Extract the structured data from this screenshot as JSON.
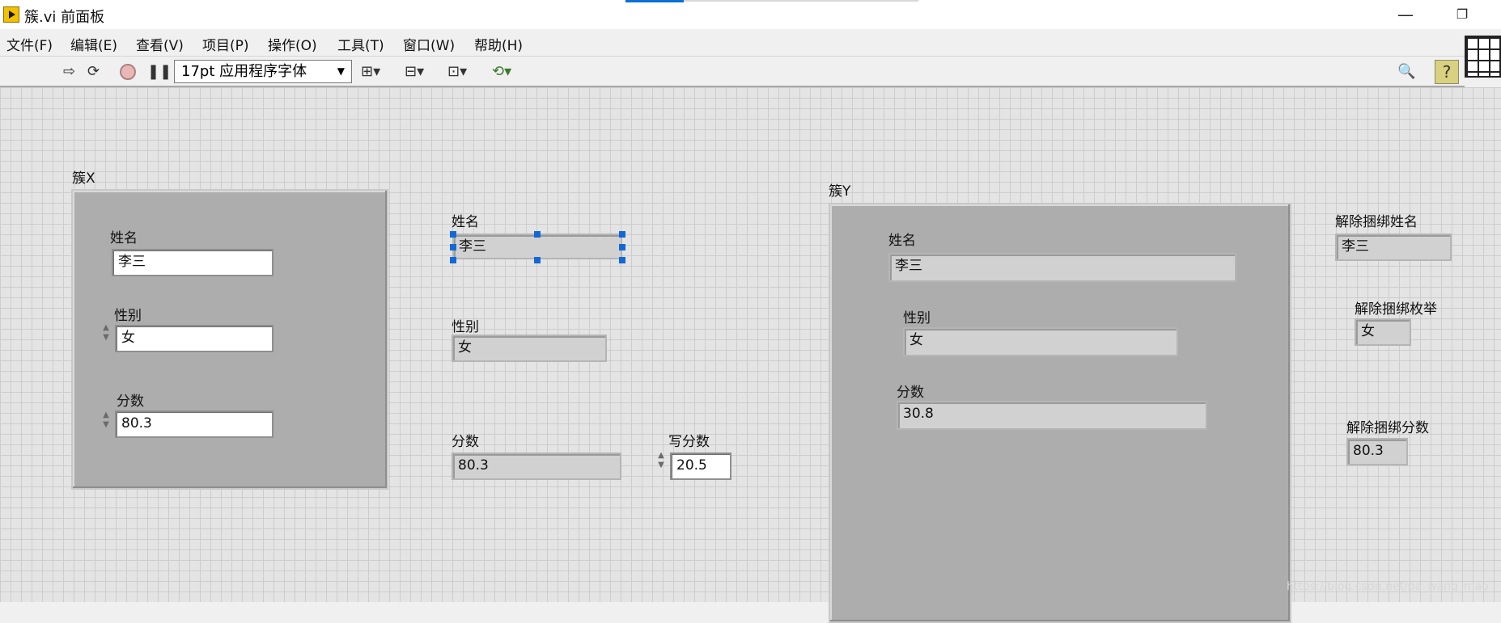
{
  "window": {
    "title": "簇.vi 前面板",
    "minimize": "—",
    "restore": "❐"
  },
  "menu": [
    "文件(F)",
    "编辑(E)",
    "查看(V)",
    "项目(P)",
    "操作(O)",
    "工具(T)",
    "窗口(W)",
    "帮助(H)"
  ],
  "toolbar": {
    "font": "17pt 应用程序字体",
    "help": "?"
  },
  "cluster_x": {
    "label": "簇X",
    "name_label": "姓名",
    "name_value": "李三",
    "gender_label": "性别",
    "gender_value": "女",
    "score_label": "分数",
    "score_value": "80.3"
  },
  "middle": {
    "name_label": "姓名",
    "name_value": "李三",
    "gender_label": "性别",
    "gender_value": "女",
    "score_label": "分数",
    "score_value": "80.3",
    "write_score_label": "写分数",
    "write_score_value": "20.5"
  },
  "cluster_y": {
    "label": "簇Y",
    "name_label": "姓名",
    "name_value": "李三",
    "gender_label": "性别",
    "gender_value": "女",
    "score_label": "分数",
    "score_value": "30.8"
  },
  "unbundle": {
    "name_label": "解除捆绑姓名",
    "name_value": "李三",
    "enum_label": "解除捆绑枚举",
    "enum_value": "女",
    "score_label": "解除捆绑分数",
    "score_value": "80.3"
  },
  "watermark": "https://blog.csdn.net/pa_wang_mao"
}
